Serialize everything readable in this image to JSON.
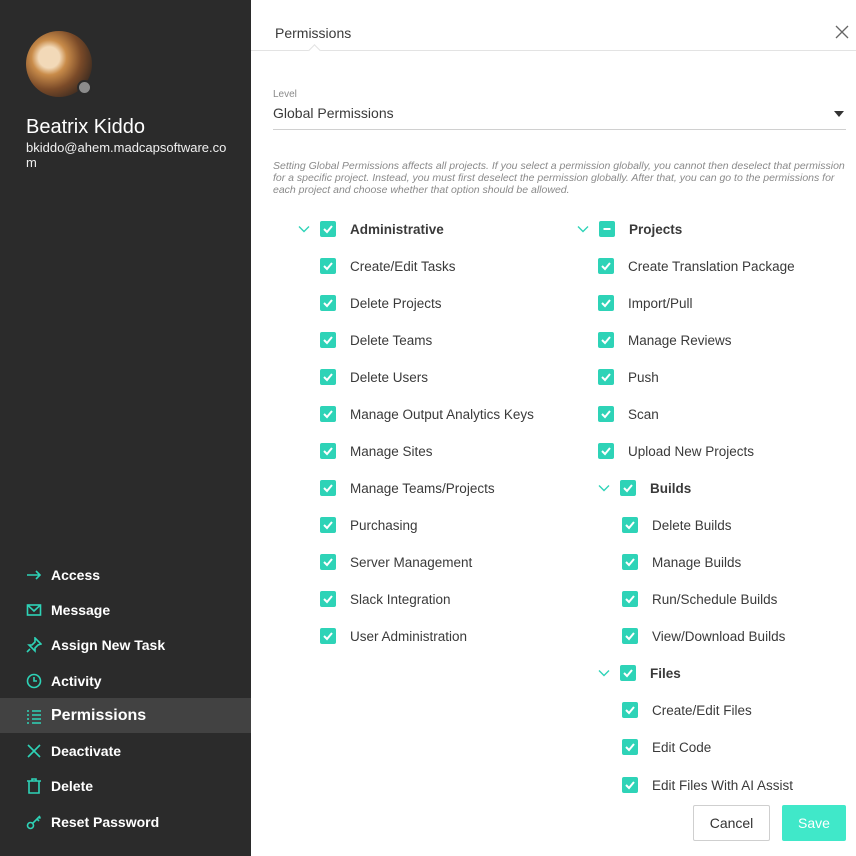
{
  "sidebar": {
    "user_name": "Beatrix Kiddo",
    "user_email": "bkiddo@ahem.madcapsoftware.com",
    "menu": [
      {
        "label": "Access",
        "icon": "arrow-right-icon"
      },
      {
        "label": "Message",
        "icon": "envelope-icon"
      },
      {
        "label": "Assign New Task",
        "icon": "pin-icon"
      },
      {
        "label": "Activity",
        "icon": "clock-icon"
      },
      {
        "label": "Permissions",
        "icon": "list-icon",
        "active": true
      },
      {
        "label": "Deactivate",
        "icon": "x-icon"
      },
      {
        "label": "Delete",
        "icon": "trash-icon"
      },
      {
        "label": "Reset Password",
        "icon": "key-icon"
      }
    ]
  },
  "panel": {
    "title": "Permissions",
    "level_label": "Level",
    "level_value": "Global Permissions",
    "note": "Setting Global Permissions affects all projects. If you select a permission globally, you cannot then deselect that permission for a specific project. Instead, you must first deselect the permission globally. After that, you can go to the permissions for each project and choose whether that option should be allowed."
  },
  "permissions": {
    "left": {
      "header": "Administrative",
      "items": [
        "Create/Edit Tasks",
        "Delete Projects",
        "Delete Teams",
        "Delete Users",
        "Manage Output Analytics Keys",
        "Manage Sites",
        "Manage Teams/Projects",
        "Purchasing",
        "Server Management",
        "Slack Integration",
        "User Administration"
      ]
    },
    "right": {
      "header": "Projects",
      "items": [
        "Create Translation Package",
        "Import/Pull",
        "Manage Reviews",
        "Push",
        "Scan",
        "Upload New Projects"
      ],
      "builds_header": "Builds",
      "builds_items": [
        "Delete Builds",
        "Manage Builds",
        "Run/Schedule Builds",
        "View/Download Builds"
      ],
      "files_header": "Files",
      "files_items": [
        "Create/Edit Files",
        "Edit Code",
        "Edit Files With AI Assist"
      ]
    }
  },
  "buttons": {
    "cancel": "Cancel",
    "save": "Save"
  },
  "colors": {
    "accent": "#2ed3b7",
    "save_button": "#40e8c9",
    "sidebar_bg": "#2b2b2b"
  }
}
